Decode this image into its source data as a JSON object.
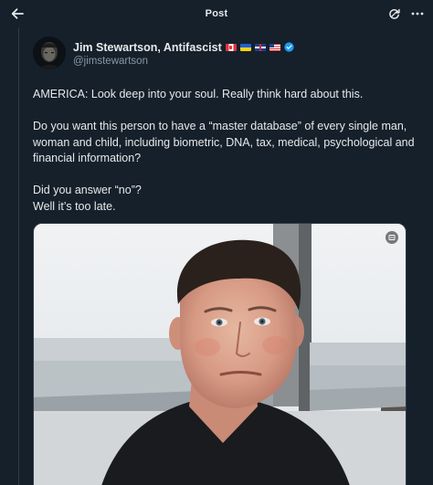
{
  "header": {
    "title": "Post",
    "back_icon": "arrow-left-icon",
    "refresh_icon": "refresh-icon",
    "more_icon": "more-icon"
  },
  "post": {
    "author": {
      "display_name": "Jim Stewartson, Antifascist",
      "handle": "@jimstewartson",
      "flags": [
        "canada-flag-icon",
        "ukraine-flag-icon",
        "uk-flag-icon",
        "us-flag-icon"
      ],
      "verified": true
    },
    "text": {
      "p1": "AMERICA: Look deep into your soul. Really think hard about this.",
      "p2": "Do you want this person to have a “master database” of every single man, woman and child, including biometric, DNA, tax, medical, psychological and financial information?",
      "p3_line1": "Did you answer “no”?",
      "p3_line2": "Well it’s too late."
    },
    "media": {
      "kind": "video",
      "badge_icon": "media-settings-icon"
    }
  },
  "colors": {
    "background": "#15202b",
    "text_primary": "#e7e9ea",
    "text_secondary": "#8b98a5",
    "verified_blue": "#1d9bf0"
  }
}
